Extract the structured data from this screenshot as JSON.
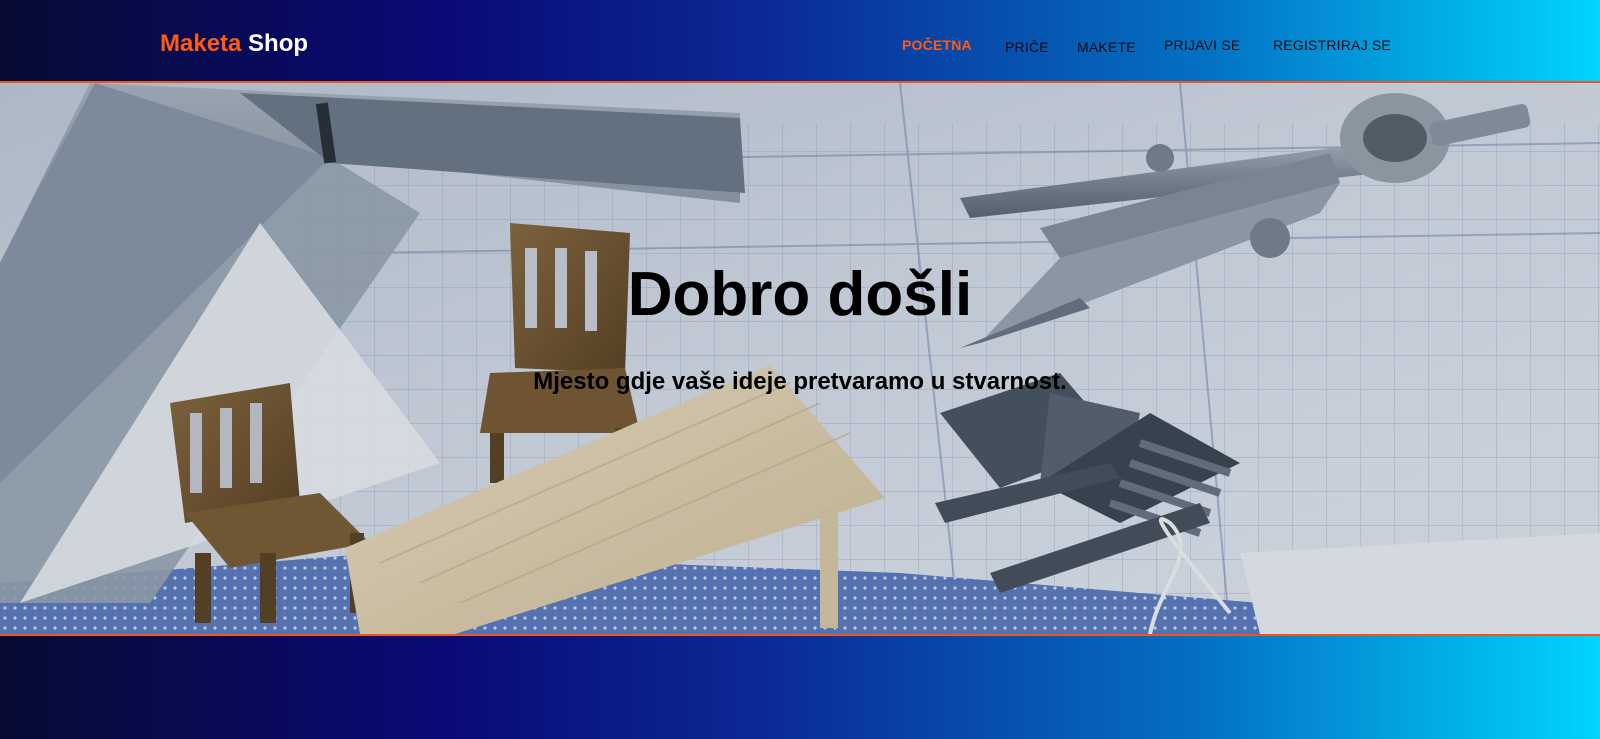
{
  "brand": {
    "part1": "Maketa",
    "part2": "Shop"
  },
  "nav": {
    "items": [
      {
        "label": "POČETNA"
      },
      {
        "label": "PRIČE"
      },
      {
        "label": "MAKETE"
      },
      {
        "label": "PRIJAVI SE"
      },
      {
        "label": "REGISTRIRAJ SE"
      }
    ]
  },
  "hero": {
    "title": "Dobro došli",
    "subtitle": "Mjesto gdje vaše ideje pretvaramo u stvarnost."
  },
  "colors": {
    "accent": "#ff5a12",
    "gradient_start": "#070b33",
    "gradient_mid": "#0a0a78",
    "gradient_end": "#00d4ff",
    "border": "#f0561c"
  }
}
